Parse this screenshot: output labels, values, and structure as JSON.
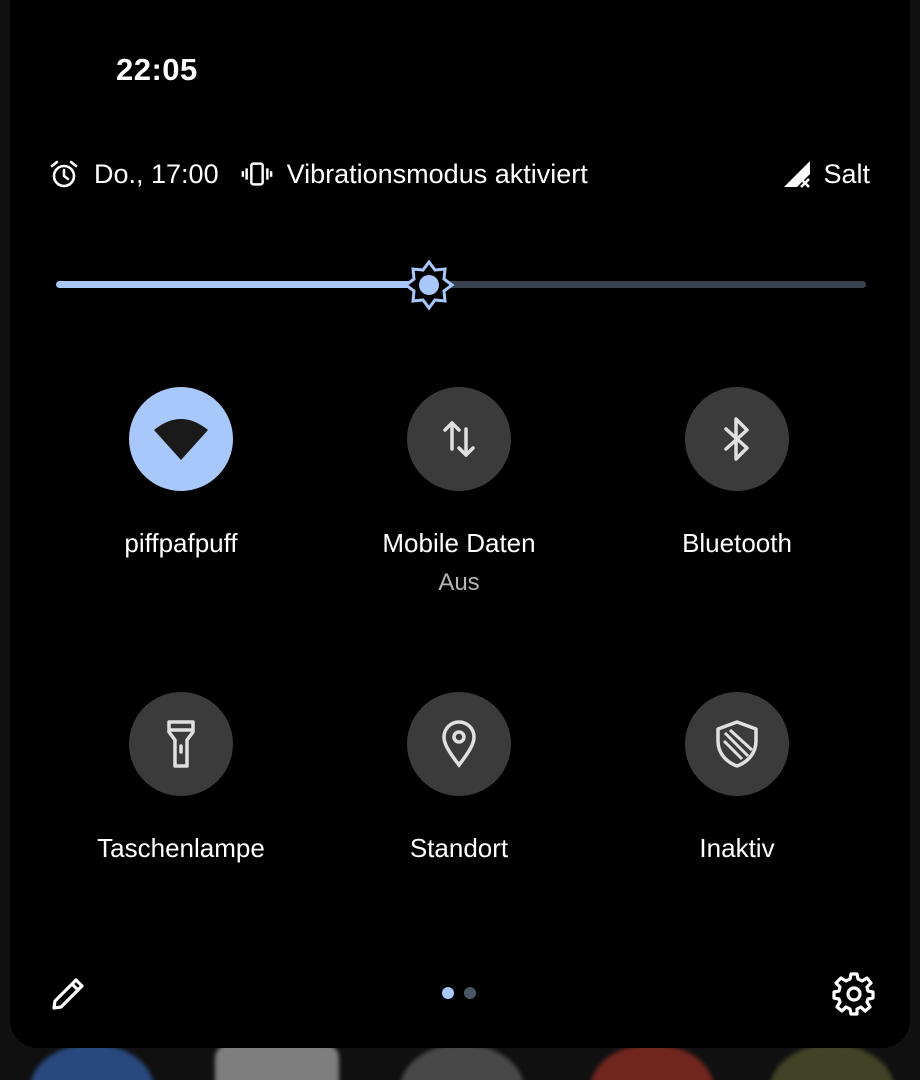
{
  "status_bar": {
    "time": "22:05"
  },
  "header": {
    "alarm_icon": "alarm-clock-icon",
    "alarm_time": "Do., 17:00",
    "vibrate_icon": "vibrate-icon",
    "vibrate_text": "Vibrationsmodus aktiviert",
    "signal_icon": "no-signal-icon",
    "carrier": "Salt"
  },
  "brightness": {
    "level": 0.46,
    "icon": "brightness-icon"
  },
  "tiles": [
    {
      "label": "piffpafpuff",
      "sub": "",
      "icon": "wifi-icon",
      "active": true
    },
    {
      "label": "Mobile Daten",
      "sub": "Aus",
      "icon": "mobile-data-icon",
      "active": false
    },
    {
      "label": "Bluetooth",
      "sub": "",
      "icon": "bluetooth-icon",
      "active": false
    },
    {
      "label": "Taschenlampe",
      "sub": "",
      "icon": "flashlight-icon",
      "active": false
    },
    {
      "label": "Standort",
      "sub": "",
      "icon": "location-icon",
      "active": false
    },
    {
      "label": "Inaktiv",
      "sub": "",
      "icon": "shield-icon",
      "active": false
    }
  ],
  "footer": {
    "edit_icon": "pencil-icon",
    "settings_icon": "gear-icon",
    "page_count": 2,
    "current_page": 1
  },
  "colors": {
    "accent": "#a8c7fa",
    "tile_off": "#3b3b3b",
    "panel_bg": "#000000",
    "dot_inactive": "#4a5566"
  }
}
